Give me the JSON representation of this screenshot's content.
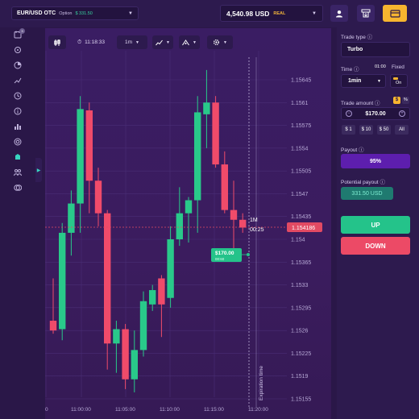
{
  "topbar": {
    "pair": "EUR/USD OTC",
    "pair_type": "Option",
    "pair_payout": "$ 331.50",
    "balance": "4,540.98 USD",
    "balance_type": "REAL"
  },
  "toolbar": {
    "timer": "11:18:33",
    "timeframe": "1m"
  },
  "chart_data": {
    "type": "candlestick",
    "x_ticks": [
      "0",
      "11:00:00",
      "11:05:00",
      "11:10:00",
      "11:15:00",
      "11:20:00"
    ],
    "y_ticks": [
      1.15645,
      1.1561,
      1.15575,
      1.1554,
      1.15505,
      1.1547,
      1.15435,
      1.154,
      1.15365,
      1.1533,
      1.15295,
      1.1526,
      1.15225,
      1.1519,
      1.15155
    ],
    "ylim": [
      1.15155,
      1.15645
    ],
    "current_price": "1.154186",
    "expiration_label": "Expiration time",
    "timer_label": "1M",
    "timer_value": "00:25",
    "trade_marker": {
      "amount": "$170.00",
      "time": "00:60"
    },
    "candles": [
      {
        "o": 1.15275,
        "h": 1.1534,
        "l": 1.15255,
        "c": 1.1526
      },
      {
        "o": 1.15262,
        "h": 1.15425,
        "l": 1.15245,
        "c": 1.1541
      },
      {
        "o": 1.1541,
        "h": 1.15475,
        "l": 1.15375,
        "c": 1.15455
      },
      {
        "o": 1.15455,
        "h": 1.1562,
        "l": 1.1541,
        "c": 1.156
      },
      {
        "o": 1.15598,
        "h": 1.1561,
        "l": 1.1544,
        "c": 1.1549
      },
      {
        "o": 1.1549,
        "h": 1.1551,
        "l": 1.1542,
        "c": 1.1544
      },
      {
        "o": 1.1544,
        "h": 1.15445,
        "l": 1.152,
        "c": 1.1524
      },
      {
        "o": 1.1524,
        "h": 1.15275,
        "l": 1.15195,
        "c": 1.15262
      },
      {
        "o": 1.15262,
        "h": 1.1527,
        "l": 1.1517,
        "c": 1.15185
      },
      {
        "o": 1.15185,
        "h": 1.1526,
        "l": 1.15165,
        "c": 1.1523
      },
      {
        "o": 1.1523,
        "h": 1.1532,
        "l": 1.1522,
        "c": 1.15305
      },
      {
        "o": 1.153,
        "h": 1.1533,
        "l": 1.1529,
        "c": 1.15322
      },
      {
        "o": 1.1534,
        "h": 1.15345,
        "l": 1.1525,
        "c": 1.153
      },
      {
        "o": 1.1531,
        "h": 1.1542,
        "l": 1.15295,
        "c": 1.154
      },
      {
        "o": 1.154,
        "h": 1.1548,
        "l": 1.1539,
        "c": 1.1544
      },
      {
        "o": 1.1544,
        "h": 1.15465,
        "l": 1.15395,
        "c": 1.1546
      },
      {
        "o": 1.1546,
        "h": 1.1562,
        "l": 1.1541,
        "c": 1.15595
      },
      {
        "o": 1.15592,
        "h": 1.1566,
        "l": 1.1554,
        "c": 1.1561
      },
      {
        "o": 1.1561,
        "h": 1.1562,
        "l": 1.1551,
        "c": 1.15515
      },
      {
        "o": 1.15515,
        "h": 1.15535,
        "l": 1.1544,
        "c": 1.15445
      },
      {
        "o": 1.15445,
        "h": 1.1549,
        "l": 1.15385,
        "c": 1.1543
      },
      {
        "o": 1.1543,
        "h": 1.1544,
        "l": 1.1541,
        "c": 1.15418
      }
    ],
    "colors": {
      "up": "#29c98a",
      "down": "#f04b6a",
      "price_line": "#e24a63"
    }
  },
  "panel": {
    "trade_type_label": "Trade type",
    "trade_type": "Turbo",
    "time_label": "Time",
    "time_value": "01:00",
    "time_select": "1min",
    "fixed_label": "Fixed",
    "fixed_state": "On",
    "amount_label": "Trade amount",
    "amount_currency": "$",
    "amount_percent": "%",
    "amount": "$170.00",
    "chips": [
      "$ 1",
      "$ 10",
      "$ 50",
      "All"
    ],
    "payout_label": "Payout",
    "payout": "95%",
    "potential_label": "Potential payout",
    "potential": "331.50 USD",
    "up_label": "UP",
    "down_label": "DOWN"
  },
  "colors": {
    "up": "#24c38a",
    "down": "#ec4a66",
    "accent_gold": "#f7b52f",
    "panel_bg": "#2d1a4e"
  }
}
